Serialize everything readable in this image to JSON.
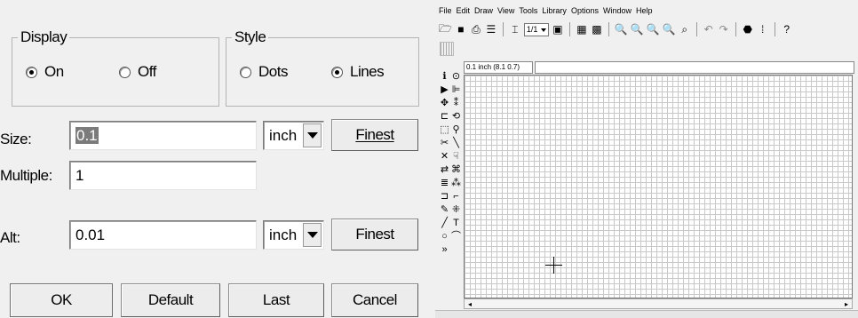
{
  "dialog": {
    "display_group": {
      "title": "Display",
      "options": [
        {
          "label": "On",
          "checked": true
        },
        {
          "label": "Off",
          "checked": false
        }
      ]
    },
    "style_group": {
      "title": "Style",
      "options": [
        {
          "label": "Dots",
          "checked": false
        },
        {
          "label": "Lines",
          "checked": true
        }
      ]
    },
    "size": {
      "label": "Size:",
      "value": "0.1",
      "unit": "inch",
      "button": "Finest"
    },
    "multiple": {
      "label": "Multiple:",
      "value": "1"
    },
    "alt": {
      "label": "Alt:",
      "value": "0.01",
      "unit": "inch",
      "button": "Finest"
    },
    "buttons": {
      "ok": "OK",
      "default": "Default",
      "last": "Last",
      "cancel": "Cancel"
    }
  },
  "app": {
    "menu": [
      "File",
      "Edit",
      "Draw",
      "View",
      "Tools",
      "Library",
      "Options",
      "Window",
      "Help"
    ],
    "toolbar": {
      "zoom_value": "1/1",
      "icons": [
        "open-icon",
        "save-icon",
        "print-icon",
        "layers-icon",
        "component-icon",
        "zoom-select",
        "library-icon",
        "grid-icon",
        "snap-icon",
        "zoom-in-icon",
        "zoom-out-icon",
        "zoom-fit-icon",
        "zoom-area-icon",
        "zoom-prev-icon",
        "undo-icon",
        "redo-icon",
        "stop-icon",
        "marker-icon",
        "help-icon"
      ]
    },
    "status_text": "0.1 inch (8.1 0.7)",
    "palette_icons": [
      "info-icon",
      "target-icon",
      "select-icon",
      "pin-icon",
      "move-icon",
      "net-icon",
      "component-icon",
      "rotate-icon",
      "rectangle-icon",
      "probe-icon",
      "cut-icon",
      "wire-icon",
      "delete-icon",
      "drag-icon",
      "flip-icon",
      "bus-icon",
      "stack-icon",
      "array-icon",
      "port-icon",
      "arc-icon",
      "pen-icon",
      "net-label-icon",
      "line-icon",
      "text-icon",
      "circle-icon",
      "arc2-icon",
      "more-icon"
    ]
  },
  "colors": {
    "dialog_bg": "#f0f0f0",
    "selection": "#7b7b7b",
    "grid_line": "#c9c9c9"
  }
}
